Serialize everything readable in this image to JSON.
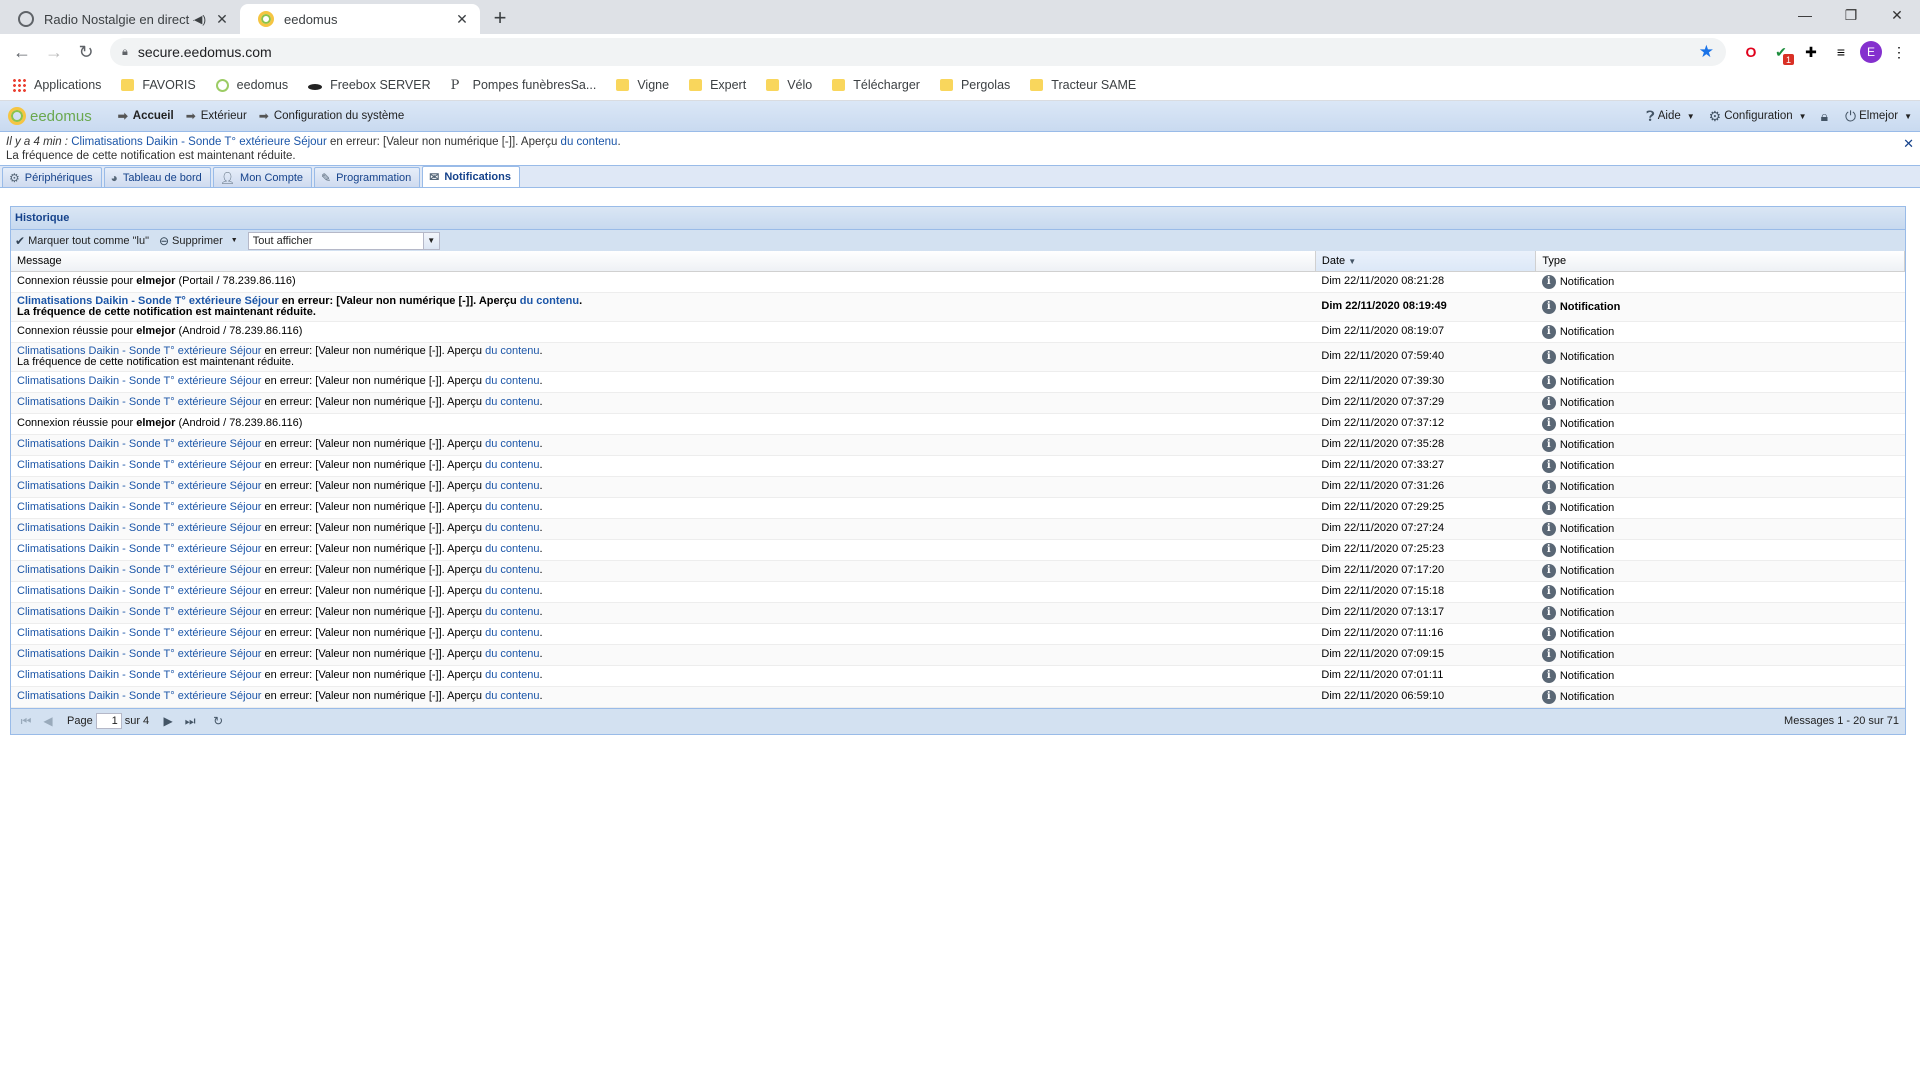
{
  "browser": {
    "tabs": [
      {
        "title": "Radio Nostalgie en direct - É",
        "active": false
      },
      {
        "title": "eedomus",
        "active": true
      }
    ],
    "url": "secure.eedomus.com",
    "ext_badge": "1",
    "avatar_letter": "E",
    "bookmarks": [
      "Applications",
      "FAVORIS",
      "eedomus",
      "Freebox SERVER",
      "Pompes funèbresSa...",
      "Vigne",
      "Expert",
      "Vélo",
      "Télécharger",
      "Pergolas",
      "Tracteur SAME"
    ]
  },
  "app": {
    "logo": "eedomus",
    "breadcrumbs": [
      "Accueil",
      "Extérieur",
      "Configuration du système"
    ],
    "right_menu": {
      "help": "Aide",
      "config": "Configuration",
      "user": "Elmejor"
    },
    "alert": {
      "ago": "Il y a 4 min :",
      "link": "Climatisations Daikin - Sonde T° extérieure Séjour",
      "text": " en erreur: [Valeur non numérique [-]]. Aperçu ",
      "link2": "du contenu",
      "line2": "La fréquence de cette notification est maintenant réduite."
    },
    "tabs": [
      "Périphériques",
      "Tableau de bord",
      "Mon Compte",
      "Programmation",
      "Notifications"
    ],
    "active_tab": "Notifications"
  },
  "panel": {
    "title": "Historique",
    "mark_read": "Marquer tout comme \"lu\"",
    "delete": "Supprimer",
    "filter": "Tout afficher",
    "columns": [
      "Message",
      "Date",
      "Type"
    ],
    "rows": [
      {
        "kind": "login",
        "pre": "Connexion réussie pour ",
        "user": "elmejor",
        "post": " (Portail / 78.239.86.116)",
        "date": "Dim 22/11/2020 08:21:28",
        "type": "Notification"
      },
      {
        "kind": "err",
        "bold": true,
        "extra": "La fréquence de cette notification est maintenant réduite.",
        "date": "Dim 22/11/2020 08:19:49",
        "type": "Notification"
      },
      {
        "kind": "login",
        "pre": "Connexion réussie pour ",
        "user": "elmejor",
        "post": " (Android / 78.239.86.116)",
        "date": "Dim 22/11/2020 08:19:07",
        "type": "Notification"
      },
      {
        "kind": "err",
        "extra": "La fréquence de cette notification est maintenant réduite.",
        "date": "Dim 22/11/2020 07:59:40",
        "type": "Notification"
      },
      {
        "kind": "err",
        "date": "Dim 22/11/2020 07:39:30",
        "type": "Notification"
      },
      {
        "kind": "err",
        "date": "Dim 22/11/2020 07:37:29",
        "type": "Notification"
      },
      {
        "kind": "login",
        "pre": "Connexion réussie pour ",
        "user": "elmejor",
        "post": " (Android / 78.239.86.116)",
        "date": "Dim 22/11/2020 07:37:12",
        "type": "Notification"
      },
      {
        "kind": "err",
        "date": "Dim 22/11/2020 07:35:28",
        "type": "Notification"
      },
      {
        "kind": "err",
        "date": "Dim 22/11/2020 07:33:27",
        "type": "Notification"
      },
      {
        "kind": "err",
        "date": "Dim 22/11/2020 07:31:26",
        "type": "Notification"
      },
      {
        "kind": "err",
        "date": "Dim 22/11/2020 07:29:25",
        "type": "Notification"
      },
      {
        "kind": "err",
        "date": "Dim 22/11/2020 07:27:24",
        "type": "Notification"
      },
      {
        "kind": "err",
        "date": "Dim 22/11/2020 07:25:23",
        "type": "Notification"
      },
      {
        "kind": "err",
        "date": "Dim 22/11/2020 07:17:20",
        "type": "Notification"
      },
      {
        "kind": "err",
        "date": "Dim 22/11/2020 07:15:18",
        "type": "Notification"
      },
      {
        "kind": "err",
        "date": "Dim 22/11/2020 07:13:17",
        "type": "Notification"
      },
      {
        "kind": "err",
        "date": "Dim 22/11/2020 07:11:16",
        "type": "Notification"
      },
      {
        "kind": "err",
        "date": "Dim 22/11/2020 07:09:15",
        "type": "Notification"
      },
      {
        "kind": "err",
        "date": "Dim 22/11/2020 07:01:11",
        "type": "Notification"
      },
      {
        "kind": "err",
        "date": "Dim 22/11/2020 06:59:10",
        "type": "Notification"
      }
    ],
    "err_template": {
      "link": "Climatisations Daikin - Sonde T° extérieure Séjour",
      "text": " en erreur: [Valeur non numérique [-]]. Aperçu ",
      "link2": "du contenu",
      "tail": "."
    },
    "pager": {
      "page_label": "Page",
      "page": "1",
      "of": "sur 4",
      "count": "Messages 1 - 20 sur 71"
    }
  },
  "colors": {
    "accent": "#15428b",
    "link": "#1c56a8",
    "border": "#99bbe8"
  }
}
